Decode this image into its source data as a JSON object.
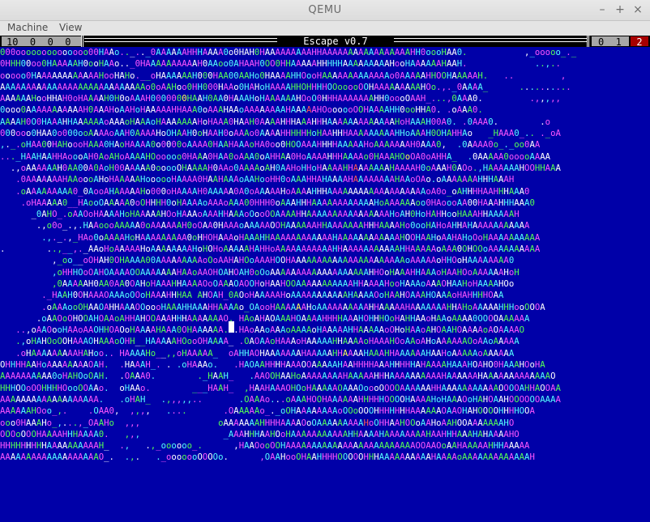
{
  "window": {
    "title": "QEMU"
  },
  "controls": {
    "minimize": "–",
    "maximize": "+",
    "close": "×"
  },
  "menu": {
    "machine": "Machine",
    "view": "View"
  },
  "hud": {
    "left_stats": "10  0  0  0",
    "title": "Escape v0.7",
    "right_stats": "0  1",
    "indicator": "2"
  },
  "field": {
    "rows": [
      "000oooooooooooooo00HAAo.._.._0AAAAAAHHHAAAA0o0HAH0HAAAAAAAAAHHAAAAAAAAAAAAAAAAAHH0oooHAA0.           ,_ooooo_._",
      "0HHH00oo0HAAAAAH0ooHAAo.._0HAAAAAAAAAAH0AAoo0AHAAH0OO0HHAAAAAHHHHHAAAAAAAAAHooHAAAAAAHAAH.             ..,..",
      "ooooo0HAAAAAAAAAAAAHooHAHo.__oHAAAAAAH000HAA00AAHo0HAAAAHHOooHAAAAAAAAAAAAAo0AAAAAHHOOHAAAAAH.   ..         ,",
      "AAAAAAAAAAAAAAAAAAAAAAAAAAAAo0oAAHoo0HH000HAAo0HAHoHAAAAHHOHHHHOOooooOOHAAAAAAAAAHOo.,._0AAAA_      ..........",
      "AAAAAAHooHHAH0oHAAAAH0H0oAAAH0000000HAAH0AA0HAAAHoHAAAAAAHOoO0HHHAAAAAAAHH0oooOAAH_...,0AAA0.         .,,,,,",
      "0ooo0AAAAAAAAAAAH0AAAHoAAHoHAAAAAHHAAA0oAAAHAAoAAAAAAAAHAAAAAHOoooooOOHAAAAHH0ooHHA0. .oAAA0.",
      "AAAAH0O0HAAAHHAAAAAAoAAAoHAAAoHAAAAAAAHoHAAA0HAAH0AAAAHHHAAAHHHAAAAAAAAAAAAAHoHAAAH00A0. .0AAA0.        .o",
      "000ooo0HAA0o000ooAAAAoAAH0AAAAHoOHAAH0oHAAH0oAAAo0AAAAHHHHHHoHAAHHHAAAAAAAAAHHoAAAH0OHAHHAo   _HAAA0_.. ._oA",
      ",._.oHAA00HAHoooHAAA0HAoHAAAA0o0000oAAAA0HAAHAAAoHA0oo0HOOAAAHHHHAAAAAHoAAAAAAAH0AAA0,  .0AAAA0o_._oo0AA",
      "..._HAAHAAHHAoooAH0AoAHoAAAAHOooooo0HAAA0HAA0oAAA0oAHHAA0HoAAAAHHHAAAAo0HAAAHOoOA0oAHHA_  .0AAAAA0ooooAAAA",
      "  .,oAAAAAAH0AA00A0AoH00AAAAA0ooooOHAAAAH0AAo0AAAAoAH0AAHoHHoHAAAAHHAAAAAAAHAAAAH0oAAAH0AOo.,HAAAAAAHOOHHAAA",
      "   .0AAAAAAAHAAoooAHoHAAAAAHoooooHAAAA0HAAHAAAoAAHooHH0oAAAHHAHAAAAHAAAAAAAAHAAoOAo.oAAAAAAAHHHAAAH",
      "   .oAAAAAAAAA0_0AooAHAAAAAHo000oHAAAAH0AAAAA0A0oAAAAAHoAAAAHHHAAAAAAAAAAAAAAAAAAAoA0o_oAHHHHAAHHHAAA0",
      "    .oHAAAAA0__HAooOAAAAA0oOHHHH0oHAAAAoAAAoAAA00HHH0oAAAHHHAAAAAAAAAAAAHoAAAAAAoo0HAoooAA00HAAAHHHAAA0",
      "      _0AHO_.oAAOoHAAAAHoHAAAAAHOoHAAAoAAAHHAAAoOooOOAAAAHHAAAAAAAAAAAAAAAAHoAH0HoHAHHooHAAAHHAAAAAH",
      "       .,o0o_.,.HAAoooAAAAA0oAAAAAAH0oOAA0HAAAoAAAAAOOHAAAAAAHHAAAAAAAHHHAAAAHo0ooHAHoAHHAHAAAAAAAAAAA",
      "        .,._.,_HAo0oAAAAHoHAAAAAAAAA0oHHOHAAAoHAAAHHAAAAAAAAAAAAHAAAAAAAAAAAAHOOHAAHoAAHAHoOoHAAAAAAAAAA",
      ".        ..,__,._AAoHoAAAAAHoAAAAAAAAHoHOHoAAAAAHAHHoAAAAAAAAAAAHHAAAAAAAAAAAHHAAAAAoAAA0OHOOoAAAAAAAAAA",
      "          ,_oo__oOHAH0OHAAAA00AAAAAAAAAoOoAAHAHOoAAAHOOHAAAAAAAAAAAAAAAAAAAAAAoAAAAAoHHOoHAAAAAAAA0",
      "          ,oHHHOoOAHOAAAAOOAAAAAAAHAAoAAOHOAHOAH0oOoAAAAAAAAAAAAAAAAAAAHHOoHAAAHHAAAoHAAHOoAAAAAAHoH",
      "          ,0AAAAAH0AA0AA0OAHoHAAAHHAAAAOoOAAAOAOOHoHAAHOOAAAAAAAAAAAHHAAAAHooHAAAoAAAOHAAHoHAAAAHOo",
      "        ._HAAH0OHAAAOAAAoOOoHAAAHHHAA AHOAH_0AOoHAAAAAHoAAAAAAAAAAAHAAAAOoHAAHOAAAHOAAAoHAHHHHOAA",
      "        .oAAAooOHAAOAHHAAAOOoooHAAAHHAAAHHAAAAo_OAooHAAAAAAHoAAAAAAAAAAHHAAAAAHAAAAAAAHHAHoAAAAAHHHooOOOA",
      "       .oAAOoOHOOAHOAAoAHHAHOOAAAHHHAAAAAAAO. HAoAHAOAAAHOAAAAHHHHAAAHOHHHOoHAHHAAoHAAoAAAA0OOOOAAAAAA",
      "   ..,oAAOooHAAoAAOHHOAOoHAAAAHAAA0OHAAAAAA. .HAoAAoAAAoAAAAoHAAAAAHHAAAAAoOHoHAAoAHOAAHOAAAAoAOAAAAO",
      "   .,oHAHOoOOHAAAOHAAAoOHH__HAAAAAHOooOHAAAA_ .OAOAAoHAAAoHAAAAAHHAAAAoHAAAHOoAAoAHoAAAAAAOoAAoAAAAA",
      "   .oHAAAAAAAAAHAHoo.. HAAAAHo__,,oHAAAAA_  oAHHAOHAAAAAAAHAAAAAHHAAAAHAAAHHAAAAAAHAAHoAAAAAoAAAAAA",
      "OHHHHAAHoAAAAAAAAOAH.  .HAAAH_. . .oHAAAo.   .HAOAAHHHHAAAOOAAAAAHAAHHHHAAAHHHHHAHAAAAHAAAHOAHO0HAAAHOoHA",
      "AAAAAAAAAA0oHAHOoOAH.  .OAAA0.        ._HAAH_   .AAOOHAAHoAAAAAAAAHAAAAAHHHAAAAAAAAAAHAAAAAAHAAAAAAAAAAAAAO",
      "HHHOOoOOHHHHOooOOAAo.  oHAAo.        ___HAAH_  ,HAAHAAAOHOoHAAAAAOAAAOoooOOOOAAAAAAHHAAAAAAAAAAAOOOOAHHAOOAA",
      "AAAAAAAAAAAAAAAAAAA.   .oHAH_  .,,,,,..       .OAAAo...oAAAHOOHAAAAAAHHHHHOOOOHAAAAHoHAAAOoHAHOAAHOOOOOOAAAA",
      "AAAAAAHOoo_,.    .OAA0,  ,,,,   ....       .OAAAAAo_._oOHAAAAAAAAoOOoOOOHHHHHHHAAAAAAOAAOHAHOOOOHHHHOOA",
      "ooo0HAAAHo_,...,_OAAHo  ,,,               oAAAAAAAHHHHAAAAOoOAAAAAAAAAHoOHHAAHOOoAAHoAAHOOAAAAAAAHO",
      "OOOoOOOHAAAAHHHAAAA0.   ,,,                _AAAHHHAAHOoHAAAAAAAAAAAHHAAAAHAAAAAAAAHAAHHHAAAHAHAAAAHO",
      "HHHHHHHHHAAAAAAAAAAH_  .,   .,_oooooo_.      ,HAAOooOOHAAAAAAAAAAAAAAAAAAAAAAAAAOOAAOoAAHAAAAAHHHAAAAA",
      "AAAAAAAAAAAAAAAAAAAO_.  .,.   ._ooooooOOOOo.      ,OAAHooOHAAHHHHOOOOOHHHAAAAAAAAAAHAAAAoAAAAAAAAAAAAAH"
    ]
  }
}
